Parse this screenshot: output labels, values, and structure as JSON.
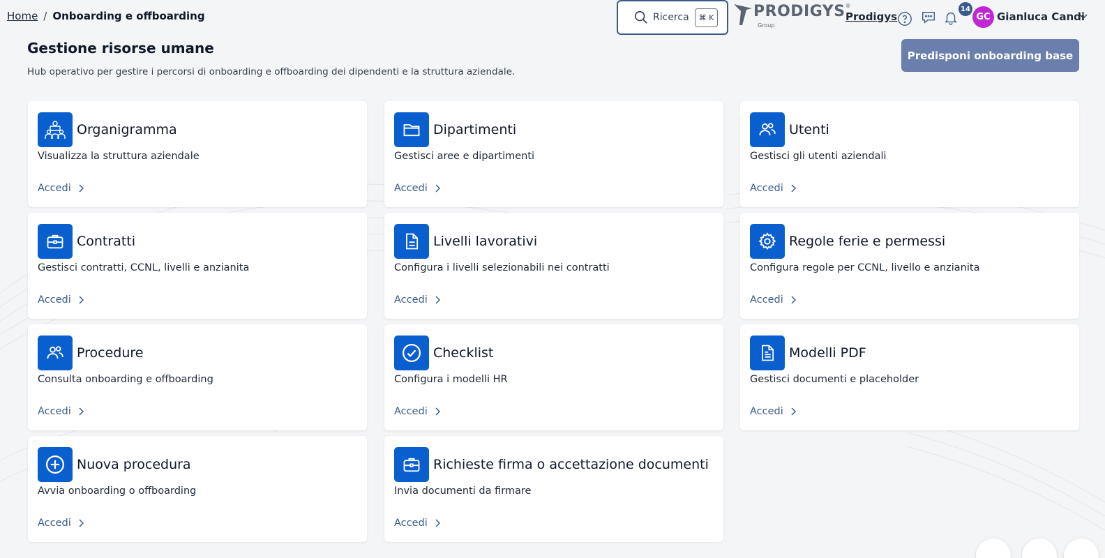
{
  "breadcrumb": {
    "home": "Home",
    "separator": "/",
    "current": "Onboarding e offboarding"
  },
  "search": {
    "label": "Ricerca",
    "shortcut": "⌘ K"
  },
  "logo": {
    "brand": "PRODIGYS",
    "reg": "®",
    "sub": "Group"
  },
  "company": "Prodigys",
  "notifications": {
    "count": "14"
  },
  "user": {
    "initials": "GC",
    "name": "Gianluca Candi",
    "avatar_color": "#c026d3"
  },
  "header": {
    "title": "Gestione risorse umane",
    "subtitle": "Hub operativo per gestire i percorsi di onboarding e offboarding dei dipendenti e la struttura aziendale.",
    "primary_action": "Predisponi onboarding base"
  },
  "colors": {
    "accent": "#0a5fcf",
    "primary_button": "#6b7fad",
    "link": "#3b5a8a"
  },
  "cards": [
    {
      "icon": "org-chart-icon",
      "title": "Organigramma",
      "desc": "Visualizza la struttura aziendale",
      "link": "Accedi"
    },
    {
      "icon": "folder-icon",
      "title": "Dipartimenti",
      "desc": "Gestisci aree e dipartimenti",
      "link": "Accedi"
    },
    {
      "icon": "users-icon",
      "title": "Utenti",
      "desc": "Gestisci gli utenti aziendali",
      "link": "Accedi"
    },
    {
      "icon": "briefcase-icon",
      "title": "Contratti",
      "desc": "Gestisci contratti, CCNL, livelli e anzianita",
      "link": "Accedi"
    },
    {
      "icon": "document-icon",
      "title": "Livelli lavorativi",
      "desc": "Configura i livelli selezionabili nei contratti",
      "link": "Accedi"
    },
    {
      "icon": "gear-icon",
      "title": "Regole ferie e permessi",
      "desc": "Configura regole per CCNL, livello e anzianita",
      "link": "Accedi"
    },
    {
      "icon": "users-icon",
      "title": "Procedure",
      "desc": "Consulta onboarding e offboarding",
      "link": "Accedi"
    },
    {
      "icon": "check-circle-icon",
      "title": "Checklist",
      "desc": "Configura i modelli HR",
      "link": "Accedi"
    },
    {
      "icon": "pdf-document-icon",
      "title": "Modelli PDF",
      "desc": "Gestisci documenti e placeholder",
      "link": "Accedi"
    },
    {
      "icon": "plus-circle-icon",
      "title": "Nuova procedura",
      "desc": "Avvia onboarding o offboarding",
      "link": "Accedi"
    },
    {
      "icon": "briefcase-icon",
      "title": "Richieste firma o accettazione documenti",
      "desc": "Invia documenti da firmare",
      "link": "Accedi"
    }
  ]
}
